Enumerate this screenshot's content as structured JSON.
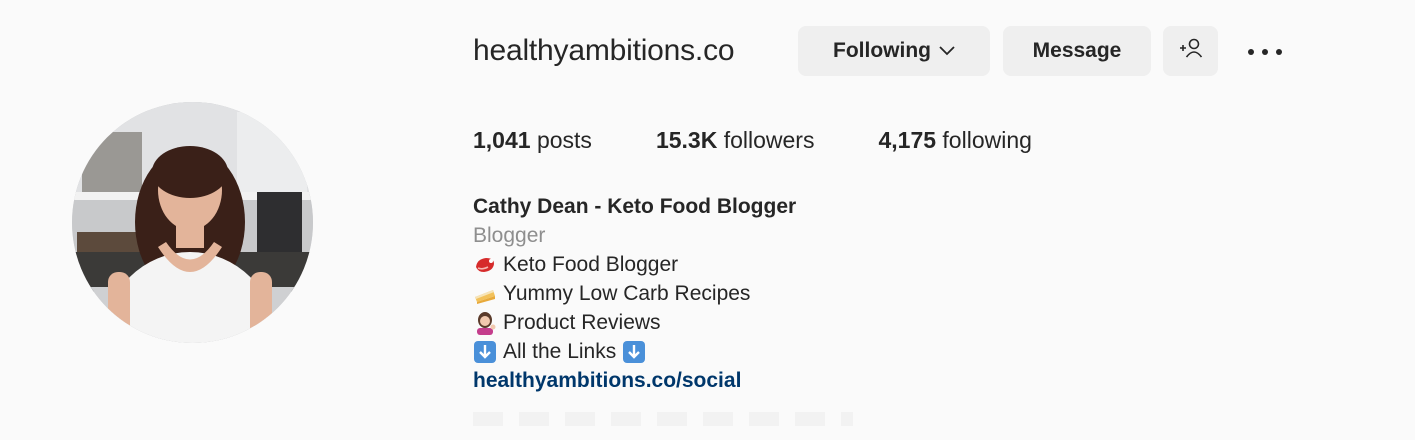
{
  "profile": {
    "username": "healthyambitions.co",
    "following_button": "Following",
    "message_button": "Message",
    "stats": {
      "posts_count": "1,041",
      "posts_label": " posts",
      "followers_count": "15.3K",
      "followers_label": " followers",
      "following_count": "4,175",
      "following_label": " following"
    },
    "bio": {
      "full_name": "Cathy Dean - Keto Food Blogger",
      "category": "Blogger",
      "lines": [
        {
          "icon": "meat-emoji-icon",
          "text": "Keto Food Blogger"
        },
        {
          "icon": "cake-emoji-icon",
          "text": "Yummy Low Carb Recipes"
        },
        {
          "icon": "woman-tipping-hand-emoji-icon",
          "text": "Product Reviews"
        }
      ],
      "links_line": "All the Links",
      "link": "healthyambitions.co/social"
    },
    "icons": {
      "following_chevron": "chevron-down-icon",
      "add_user": "add-user-icon",
      "more": "more-options-icon",
      "down_arrow": "down-arrow-emoji-icon"
    }
  },
  "colors": {
    "background": "#fafafa",
    "button_bg": "#efefef",
    "text": "#262626",
    "muted": "#8e8e8e",
    "link": "#00376b",
    "emoji_blue": "#4a90d9"
  }
}
